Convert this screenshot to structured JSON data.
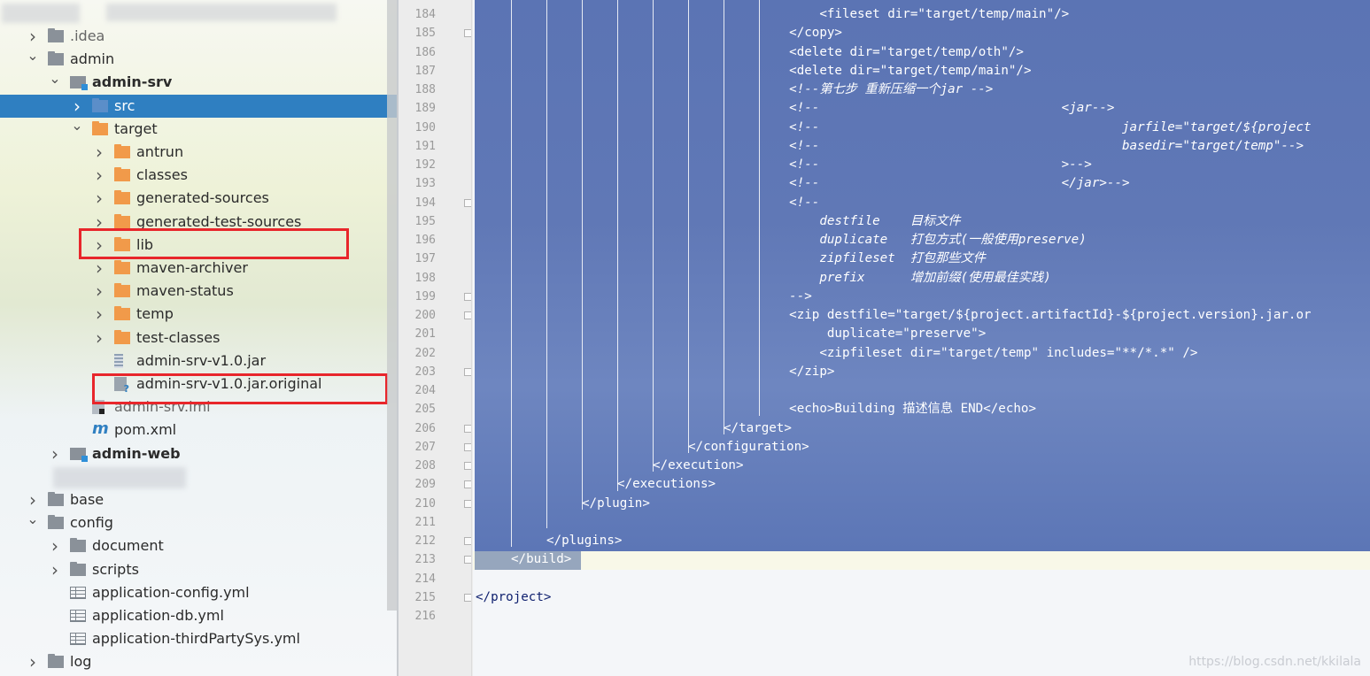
{
  "tree": {
    "rows": [
      {
        "label": ".idea",
        "indent": 0,
        "chevron": "›",
        "icon": "folder-grey",
        "faded": true
      },
      {
        "label": "admin",
        "indent": 0,
        "chevron": "⌄",
        "icon": "folder-grey"
      },
      {
        "label": "admin-srv",
        "indent": 1,
        "chevron": "⌄",
        "icon": "module",
        "bold": true
      },
      {
        "label": "src",
        "indent": 2,
        "chevron": "›",
        "icon": "folder-blue",
        "selected": true
      },
      {
        "label": "target",
        "indent": 2,
        "chevron": "⌄",
        "icon": "folder-orange"
      },
      {
        "label": "antrun",
        "indent": 3,
        "chevron": "›",
        "icon": "folder-orange"
      },
      {
        "label": "classes",
        "indent": 3,
        "chevron": "›",
        "icon": "folder-orange"
      },
      {
        "label": "generated-sources",
        "indent": 3,
        "chevron": "›",
        "icon": "folder-orange"
      },
      {
        "label": "generated-test-sources",
        "indent": 3,
        "chevron": "›",
        "icon": "folder-orange"
      },
      {
        "label": "lib",
        "indent": 3,
        "chevron": "›",
        "icon": "folder-orange"
      },
      {
        "label": "maven-archiver",
        "indent": 3,
        "chevron": "›",
        "icon": "folder-orange"
      },
      {
        "label": "maven-status",
        "indent": 3,
        "chevron": "›",
        "icon": "folder-orange"
      },
      {
        "label": "temp",
        "indent": 3,
        "chevron": "›",
        "icon": "folder-orange"
      },
      {
        "label": "test-classes",
        "indent": 3,
        "chevron": "›",
        "icon": "folder-orange"
      },
      {
        "label": "admin-srv-v1.0.jar",
        "indent": 3,
        "chevron": "",
        "icon": "jar"
      },
      {
        "label": "admin-srv-v1.0.jar.original",
        "indent": 3,
        "chevron": "",
        "icon": "unknown-file"
      },
      {
        "label": "admin-srv.iml",
        "indent": 2,
        "chevron": "",
        "icon": "iml",
        "faded": true
      },
      {
        "label": "pom.xml",
        "indent": 2,
        "chevron": "",
        "icon": "maven"
      },
      {
        "label": "admin-web",
        "indent": 1,
        "chevron": "›",
        "icon": "module",
        "bold": true
      },
      {
        "label": "",
        "indent": 1,
        "chevron": "",
        "icon": "",
        "blurred": true
      },
      {
        "label": "base",
        "indent": 0,
        "chevron": "›",
        "icon": "folder-grey"
      },
      {
        "label": "config",
        "indent": 0,
        "chevron": "⌄",
        "icon": "folder-grey"
      },
      {
        "label": "document",
        "indent": 1,
        "chevron": "›",
        "icon": "folder-grey"
      },
      {
        "label": "scripts",
        "indent": 1,
        "chevron": "›",
        "icon": "folder-grey"
      },
      {
        "label": "application-config.yml",
        "indent": 1,
        "chevron": "",
        "icon": "yml"
      },
      {
        "label": "application-db.yml",
        "indent": 1,
        "chevron": "",
        "icon": "yml"
      },
      {
        "label": "application-thirdPartySys.yml",
        "indent": 1,
        "chevron": "",
        "icon": "yml"
      },
      {
        "label": "log",
        "indent": 0,
        "chevron": "›",
        "icon": "folder-grey"
      }
    ]
  },
  "editor": {
    "lines": [
      {
        "n": "184",
        "text": "        <fileset dir=\"target/temp/main\"/>",
        "depth": 8
      },
      {
        "n": "185",
        "text": "    </copy>",
        "depth": 8,
        "fold": true
      },
      {
        "n": "186",
        "text": "    <delete dir=\"target/temp/oth\"/>",
        "depth": 8
      },
      {
        "n": "187",
        "text": "    <delete dir=\"target/temp/main\"/>",
        "depth": 8
      },
      {
        "n": "188",
        "text": "    <!--第七步 重新压缩一个jar -->",
        "depth": 8,
        "comment": true
      },
      {
        "n": "189",
        "text": "    <!--                                <jar-->",
        "depth": 8,
        "comment": true
      },
      {
        "n": "190",
        "text": "    <!--                                        jarfile=\"target/${project",
        "depth": 8,
        "comment": true
      },
      {
        "n": "191",
        "text": "    <!--                                        basedir=\"target/temp\"-->",
        "depth": 8,
        "comment": true
      },
      {
        "n": "192",
        "text": "    <!--                                >-->",
        "depth": 8,
        "comment": true
      },
      {
        "n": "193",
        "text": "    <!--                                </jar>-->",
        "depth": 8,
        "comment": true
      },
      {
        "n": "194",
        "text": "    <!--",
        "depth": 8,
        "comment": true,
        "fold": true
      },
      {
        "n": "195",
        "text": "        destfile    目标文件",
        "depth": 8,
        "comment": true
      },
      {
        "n": "196",
        "text": "        duplicate   打包方式(一般使用preserve)",
        "depth": 8,
        "comment": true
      },
      {
        "n": "197",
        "text": "        zipfileset  打包那些文件",
        "depth": 8,
        "comment": true
      },
      {
        "n": "198",
        "text": "        prefix      增加前缀(使用最佳实践)",
        "depth": 8,
        "comment": true
      },
      {
        "n": "199",
        "text": "    -->",
        "depth": 8,
        "comment": true,
        "fold": true
      },
      {
        "n": "200",
        "text": "    <zip destfile=\"target/${project.artifactId}-${project.version}.jar.or",
        "depth": 8,
        "fold": true
      },
      {
        "n": "201",
        "text": "         duplicate=\"preserve\">",
        "depth": 8
      },
      {
        "n": "202",
        "text": "        <zipfileset dir=\"target/temp\" includes=\"**/*.*\" />",
        "depth": 8
      },
      {
        "n": "203",
        "text": "    </zip>",
        "depth": 8,
        "fold": true
      },
      {
        "n": "204",
        "text": "",
        "depth": 8
      },
      {
        "n": "205",
        "text": "    <echo>Building 描述信息 END</echo>",
        "depth": 8
      },
      {
        "n": "206",
        "text": "</target>",
        "depth": 7,
        "fold": true
      },
      {
        "n": "207",
        "text": "</configuration>",
        "depth": 6,
        "fold": true
      },
      {
        "n": "208",
        "text": "</execution>",
        "depth": 5,
        "fold": true
      },
      {
        "n": "209",
        "text": "</executions>",
        "depth": 4,
        "fold": true
      },
      {
        "n": "210",
        "text": "</plugin>",
        "depth": 3,
        "fold": true
      },
      {
        "n": "211",
        "text": "",
        "depth": 2
      },
      {
        "n": "212",
        "text": "</plugins>",
        "depth": 2,
        "fold": true
      },
      {
        "n": "213",
        "text": "</build>",
        "depth": 1,
        "fold": true
      },
      {
        "n": "214",
        "text": "",
        "depth": 0
      },
      {
        "n": "215",
        "text": "</project>",
        "depth": 0,
        "fold": true
      },
      {
        "n": "216",
        "text": "",
        "depth": 0
      }
    ],
    "watermark": "https://blog.csdn.net/kkilala"
  },
  "colors": {
    "selection": "#5b74b4",
    "tree_selected": "#2f7fc1",
    "highlight_box": "#e8262b"
  }
}
